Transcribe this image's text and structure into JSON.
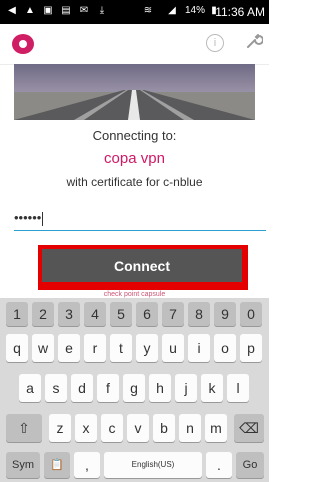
{
  "statusbar": {
    "time": "11:36 AM",
    "battery": "14%",
    "icons": [
      "back-icon",
      "warning-icon",
      "screen-icon",
      "image-icon",
      "mail-icon",
      "download-icon",
      "wifi-icon",
      "signal-icon",
      "battery-icon"
    ]
  },
  "appbar": {
    "info_icon": "i",
    "wrench_icon": "🔧"
  },
  "dialog": {
    "connecting_label": "Connecting to:",
    "vpn_name": "copa vpn",
    "cert_text": "with certificate for c-nblue",
    "password_value": "••••••",
    "connect_label": "Connect",
    "hint": "check point capsule"
  },
  "colors": {
    "accent": "#d01866",
    "highlight_border": "#e50000",
    "button": "#555555"
  },
  "keyboard": {
    "numbers": [
      "1",
      "2",
      "3",
      "4",
      "5",
      "6",
      "7",
      "8",
      "9",
      "0"
    ],
    "row1": [
      "q",
      "w",
      "e",
      "r",
      "t",
      "y",
      "u",
      "i",
      "o",
      "p"
    ],
    "row2": [
      "a",
      "s",
      "d",
      "f",
      "g",
      "h",
      "j",
      "k",
      "l"
    ],
    "row3": [
      "z",
      "x",
      "c",
      "v",
      "b",
      "n",
      "m"
    ],
    "row3_sups": [
      "",
      "",
      "",
      "",
      "",
      "",
      ""
    ],
    "shift": "⇧",
    "backspace": "⌫",
    "sym": "Sym",
    "clipboard": "📋",
    "comma": ",",
    "space": "English(US)",
    "period": ".",
    "go": "Go"
  }
}
